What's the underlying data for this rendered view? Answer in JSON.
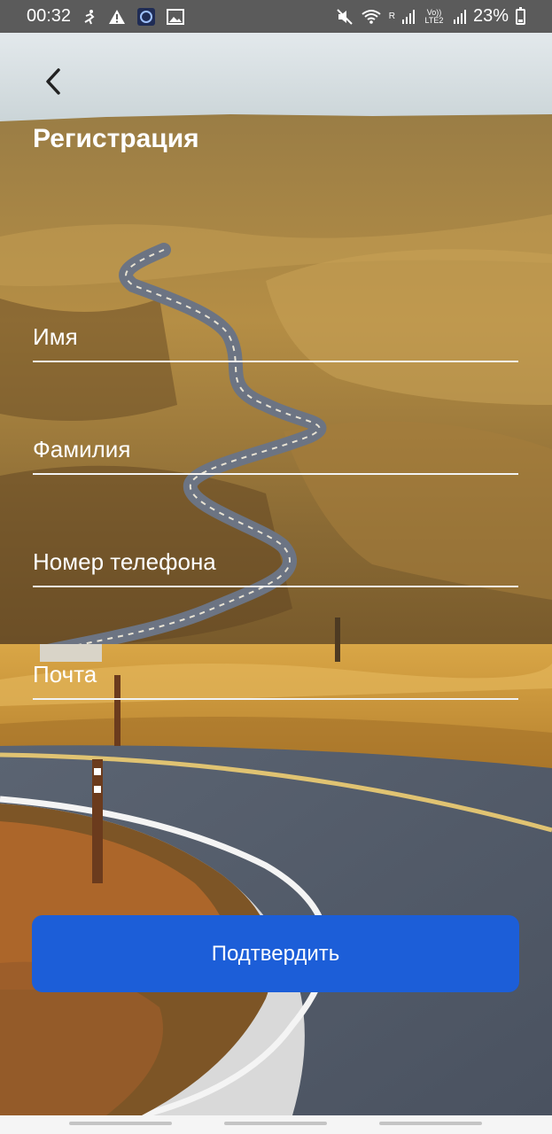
{
  "status_bar": {
    "time": "00:32",
    "signal_1": "R",
    "signal_2": "Vo)) LTE2",
    "battery_percent": "23%",
    "icons": [
      "person-run-icon",
      "alert-icon",
      "app-icon",
      "image-icon",
      "mute-icon",
      "wifi-icon",
      "signal-icon",
      "battery-icon"
    ]
  },
  "header": {
    "back_icon": "chevron-left-icon",
    "title": "Регистрация"
  },
  "form": {
    "first_name_placeholder": "Имя",
    "last_name_placeholder": "Фамилия",
    "phone_placeholder": "Номер телефона",
    "email_placeholder": "Почта",
    "submit_label": "Подтвердить"
  },
  "colors": {
    "accent": "#1c5ed8",
    "status_bar": "#5b5b5b",
    "text": "#ffffff"
  }
}
